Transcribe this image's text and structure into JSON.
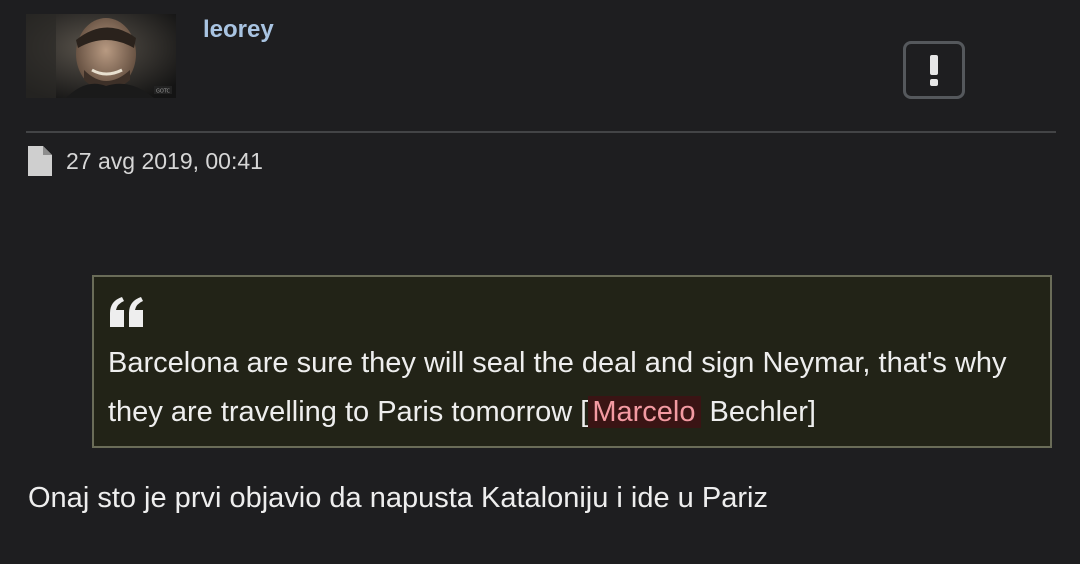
{
  "post": {
    "author": {
      "username": "leorey",
      "avatar_label": "avatar",
      "avatar_badge": "GOTC"
    },
    "report_icon": "exclamation-icon",
    "meta": {
      "file_icon": "file-icon",
      "timestamp": "27 avg 2019, 00:41"
    },
    "quote": {
      "icon": "quote-icon",
      "text_before": "Barcelona are sure they will seal the deal and sign Neymar, that's why they are travelling to Paris tomorrow [",
      "mention": "Marcelo",
      "text_after": " Bechler]"
    },
    "body": "Onaj sto je prvi objavio da napusta Kataloniju i ide u Pariz"
  },
  "colors": {
    "background": "#1e1e20",
    "username": "#a9c4e2",
    "quote_border": "#6a6c58",
    "quote_bg": "#222317",
    "mention_bg": "#3a1414",
    "mention_text": "#f39aa2"
  }
}
